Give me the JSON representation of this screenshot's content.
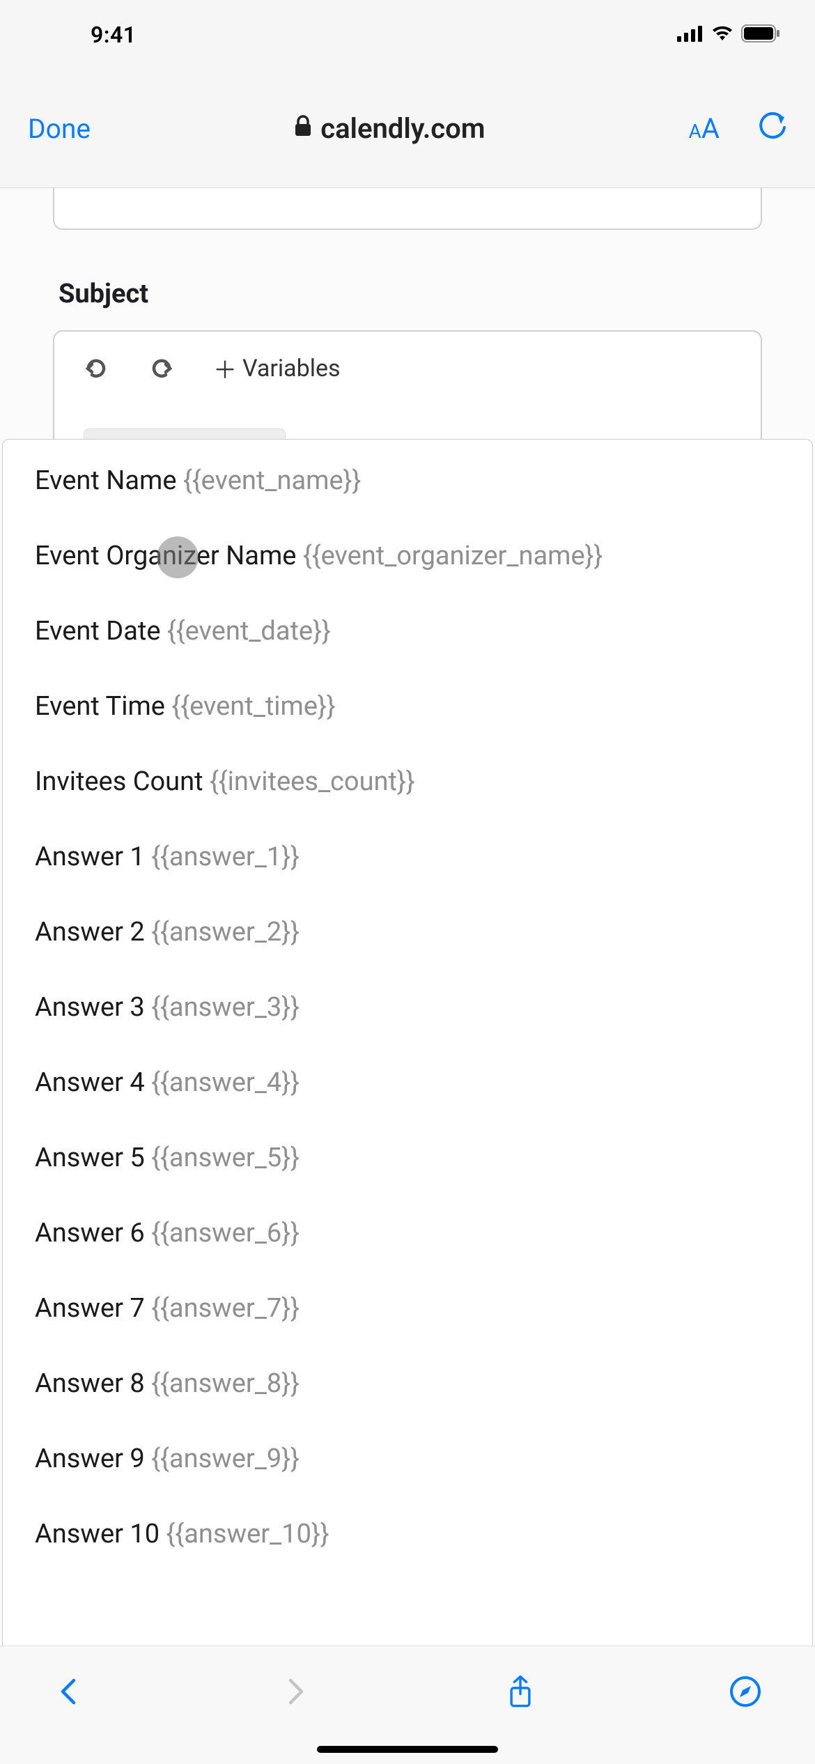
{
  "status": {
    "time": "9:41"
  },
  "browser": {
    "done_label": "Done",
    "url": "calendly.com"
  },
  "page": {
    "subject_label": "Subject",
    "variables_btn": "Variables"
  },
  "variables": [
    {
      "label": "Event Name",
      "token": "{{event_name}}"
    },
    {
      "label": "Event Organizer Name",
      "token": "{{event_organizer_name}}"
    },
    {
      "label": "Event Date",
      "token": "{{event_date}}"
    },
    {
      "label": "Event Time",
      "token": "{{event_time}}"
    },
    {
      "label": "Invitees Count",
      "token": "{{invitees_count}}"
    },
    {
      "label": "Answer 1",
      "token": "{{answer_1}}"
    },
    {
      "label": "Answer 2",
      "token": "{{answer_2}}"
    },
    {
      "label": "Answer 3",
      "token": "{{answer_3}}"
    },
    {
      "label": "Answer 4",
      "token": "{{answer_4}}"
    },
    {
      "label": "Answer 5",
      "token": "{{answer_5}}"
    },
    {
      "label": "Answer 6",
      "token": "{{answer_6}}"
    },
    {
      "label": "Answer 7",
      "token": "{{answer_7}}"
    },
    {
      "label": "Answer 8",
      "token": "{{answer_8}}"
    },
    {
      "label": "Answer 9",
      "token": "{{answer_9}}"
    },
    {
      "label": "Answer 10",
      "token": "{{answer_10}}"
    }
  ]
}
